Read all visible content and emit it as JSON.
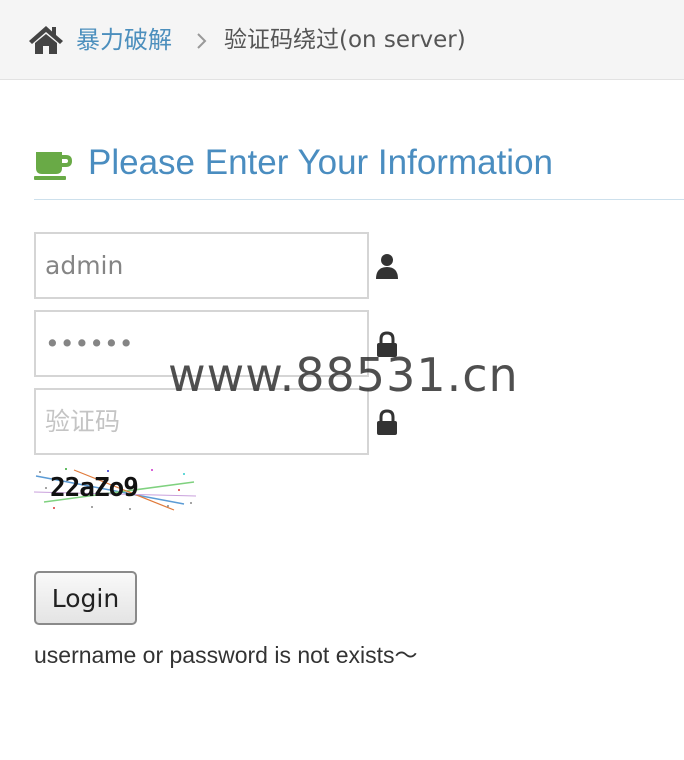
{
  "breadcrumb": {
    "home_icon": "home-icon",
    "link_label": "暴力破解",
    "separator_icon": "chevron-right-icon",
    "current_label": "验证码绕过(on server)"
  },
  "header": {
    "icon": "coffee-icon",
    "icon_color": "#69aa46",
    "title": "Please Enter Your Information"
  },
  "form": {
    "username": {
      "value": "admin",
      "icon": "user-icon"
    },
    "password": {
      "value": "••••••",
      "icon": "lock-icon"
    },
    "captcha_input": {
      "placeholder": "验证码",
      "icon": "lock-icon"
    },
    "captcha_image_text": "22aZo9",
    "login_label": "Login"
  },
  "message": "username or password is not exists～",
  "watermark": "www.88531.cn",
  "colors": {
    "link": "#4c8fbd",
    "title": "#4a8dc0",
    "breadcrumb_bg": "#f5f5f5"
  }
}
